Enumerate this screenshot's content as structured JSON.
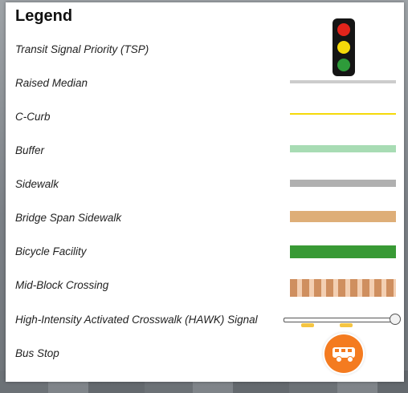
{
  "legend": {
    "title": "Legend",
    "items": [
      {
        "label": "Transit Signal Priority (TSP)",
        "icon": "traffic-signal-icon"
      },
      {
        "label": "Raised Median",
        "color": "#cccccc"
      },
      {
        "label": "C-Curb",
        "color": "#f5d90a"
      },
      {
        "label": "Buffer",
        "color": "#a8dcb4"
      },
      {
        "label": "Sidewalk",
        "color": "#b0b0b0"
      },
      {
        "label": "Bridge Span Sidewalk",
        "color": "#deae78"
      },
      {
        "label": "Bicycle Facility",
        "color": "#389a35"
      },
      {
        "label": "Mid-Block Crossing",
        "colors": [
          "#cf8f5f",
          "#f3cfb2"
        ]
      },
      {
        "label": "High-Intensity Activated Crosswalk (HAWK) Signal",
        "icon": "hawk-signal-icon",
        "colors": [
          "#ffffff",
          "#f5c542"
        ]
      },
      {
        "label": "Bus Stop",
        "icon": "bus-icon",
        "color": "#f47b20"
      }
    ],
    "signal_lamp_colors": [
      "#e2241b",
      "#f5d90a",
      "#2e9b3a"
    ]
  }
}
